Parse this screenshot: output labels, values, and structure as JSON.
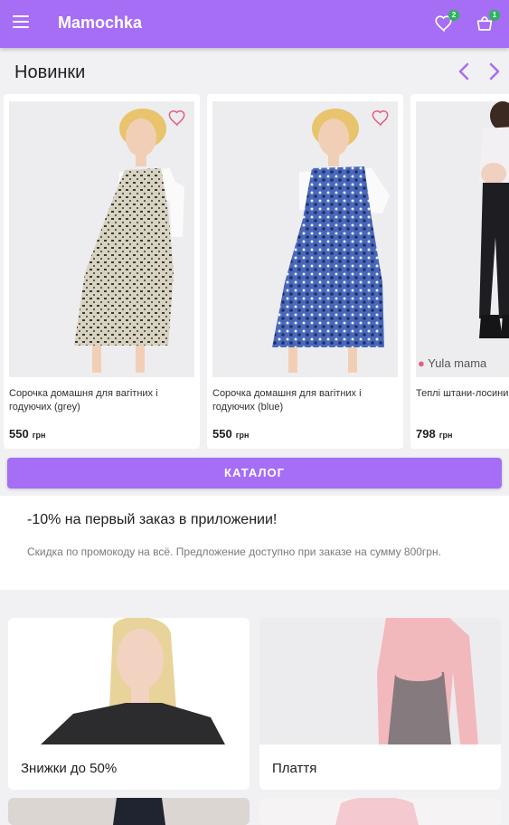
{
  "appbar": {
    "title": "Mamochka",
    "favorites_count": "2",
    "cart_count": "1"
  },
  "new_section": {
    "title": "Новинки"
  },
  "products": [
    {
      "name": "Сорочка домашня для вагітних і годуючих (grey)",
      "price": "550",
      "currency": "грн"
    },
    {
      "name": "Сорочка домашня для вагітних і годуючих (blue)",
      "price": "550",
      "currency": "грн"
    },
    {
      "name": "Теплі штани-лосини чорний",
      "price": "798",
      "currency": "грн",
      "watermark": "Yula mama"
    }
  ],
  "catalog_button": "КАТАЛОГ",
  "promo": {
    "title": "-10% на первый заказ в приложении!",
    "text": "Скидка по промокоду на всё. Предложение доступно при заказе на сумму 800грн."
  },
  "categories": [
    {
      "label": "Знижки до 50%"
    },
    {
      "label": "Плаття"
    }
  ],
  "colors": {
    "accent": "#a56ef5",
    "badge": "#2db35b",
    "heart": "#e0607e"
  },
  "icons": [
    "menu-icon",
    "heart-icon",
    "cart-icon",
    "chevron-left-icon",
    "chevron-right-icon"
  ]
}
